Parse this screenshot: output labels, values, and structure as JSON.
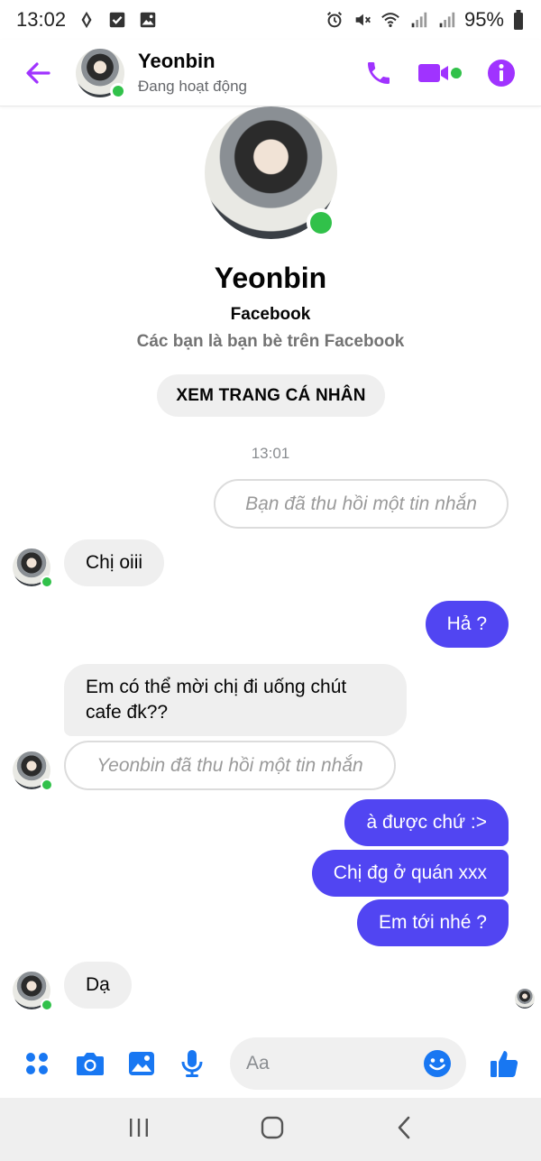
{
  "status_bar": {
    "time": "13:02",
    "battery": "95%",
    "left_icons": [
      "diamond-icon",
      "checkbox-icon",
      "gallery-icon"
    ],
    "right_icons": [
      "alarm-icon",
      "mute-icon",
      "wifi-icon",
      "signal-icon",
      "signal-icon",
      "battery-icon"
    ]
  },
  "header": {
    "name": "Yeonbin",
    "status": "Đang hoạt động",
    "accent": "#a033ff"
  },
  "profile": {
    "name": "Yeonbin",
    "platform": "Facebook",
    "friends_text": "Các bạn là bạn bè trên Facebook",
    "view_profile_label": "XEM TRANG CÁ NHÂN"
  },
  "conversation": {
    "time_separator": "13:01",
    "messages": [
      {
        "from": "me",
        "kind": "recalled",
        "text": "Bạn đã thu hồi một tin nhắn"
      },
      {
        "from": "them",
        "kind": "text",
        "text": "Chị oiii"
      },
      {
        "from": "me",
        "kind": "text",
        "text": "Hả ?"
      },
      {
        "from": "them",
        "kind": "text",
        "text": "Em có thể mời chị đi uống chút cafe đk??"
      },
      {
        "from": "them",
        "kind": "recalled",
        "text": "Yeonbin đã thu hồi một tin nhắn"
      },
      {
        "from": "me",
        "kind": "text",
        "text": "à được chứ :>"
      },
      {
        "from": "me",
        "kind": "text",
        "text": "Chị đg ở quán xxx"
      },
      {
        "from": "me",
        "kind": "text",
        "text": "Em tới nhé ?"
      },
      {
        "from": "them",
        "kind": "text",
        "text": "Dạ"
      }
    ],
    "colors": {
      "outgoing": "#5145f2",
      "incoming": "#efefef"
    }
  },
  "composer": {
    "placeholder": "Aa",
    "icons": [
      "menu-grid-icon",
      "camera-icon",
      "image-icon",
      "microphone-icon",
      "emoji-icon",
      "thumbs-up-icon"
    ],
    "accent": "#1877f2"
  },
  "nav_bar": {
    "icons": [
      "recent-apps-icon",
      "home-icon",
      "back-icon"
    ]
  }
}
